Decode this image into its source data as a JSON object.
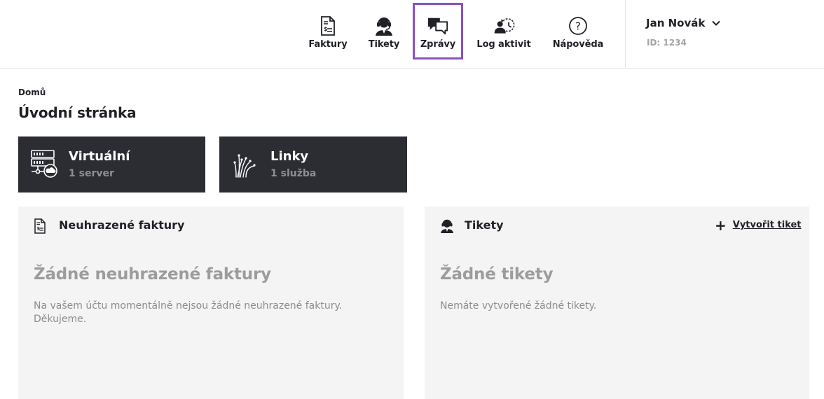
{
  "nav": {
    "items": [
      {
        "label": "Faktury",
        "icon": "invoice-icon"
      },
      {
        "label": "Tikety",
        "icon": "support-agent-icon"
      },
      {
        "label": "Zprávy",
        "icon": "chat-bubbles-icon"
      },
      {
        "label": "Log aktivit",
        "icon": "activity-log-icon"
      },
      {
        "label": "Nápověda",
        "icon": "help-icon"
      }
    ],
    "active_label": "Zprávy",
    "active_color": "#8a4fc7"
  },
  "user": {
    "name": "Jan Novák",
    "id_text": "ID: 1234"
  },
  "breadcrumb": "Domů",
  "page_title": "Úvodní stránka",
  "services": [
    {
      "name": "Virtuální",
      "count": "1 server",
      "icon": "virtual-server-icon"
    },
    {
      "name": "Linky",
      "count": "1 služba",
      "icon": "fiber-optic-icon"
    }
  ],
  "panels": {
    "invoices": {
      "title": "Neuhrazené faktury",
      "empty_title": "Žádné neuhrazené faktury",
      "empty_text": "Na vašem účtu momentálně nejsou žádné neuhrazené faktury. Děkujeme."
    },
    "tickets": {
      "title": "Tikety",
      "create_label": "Vytvořit tiket",
      "empty_title": "Žádné tikety",
      "empty_text": "Nemáte vytvořené žádné tikety."
    }
  },
  "colors": {
    "tile_bg": "#2b2d33",
    "panel_bg": "#f4f4f4",
    "text_dark": "#1f2126",
    "muted": "#9c9c9c"
  }
}
